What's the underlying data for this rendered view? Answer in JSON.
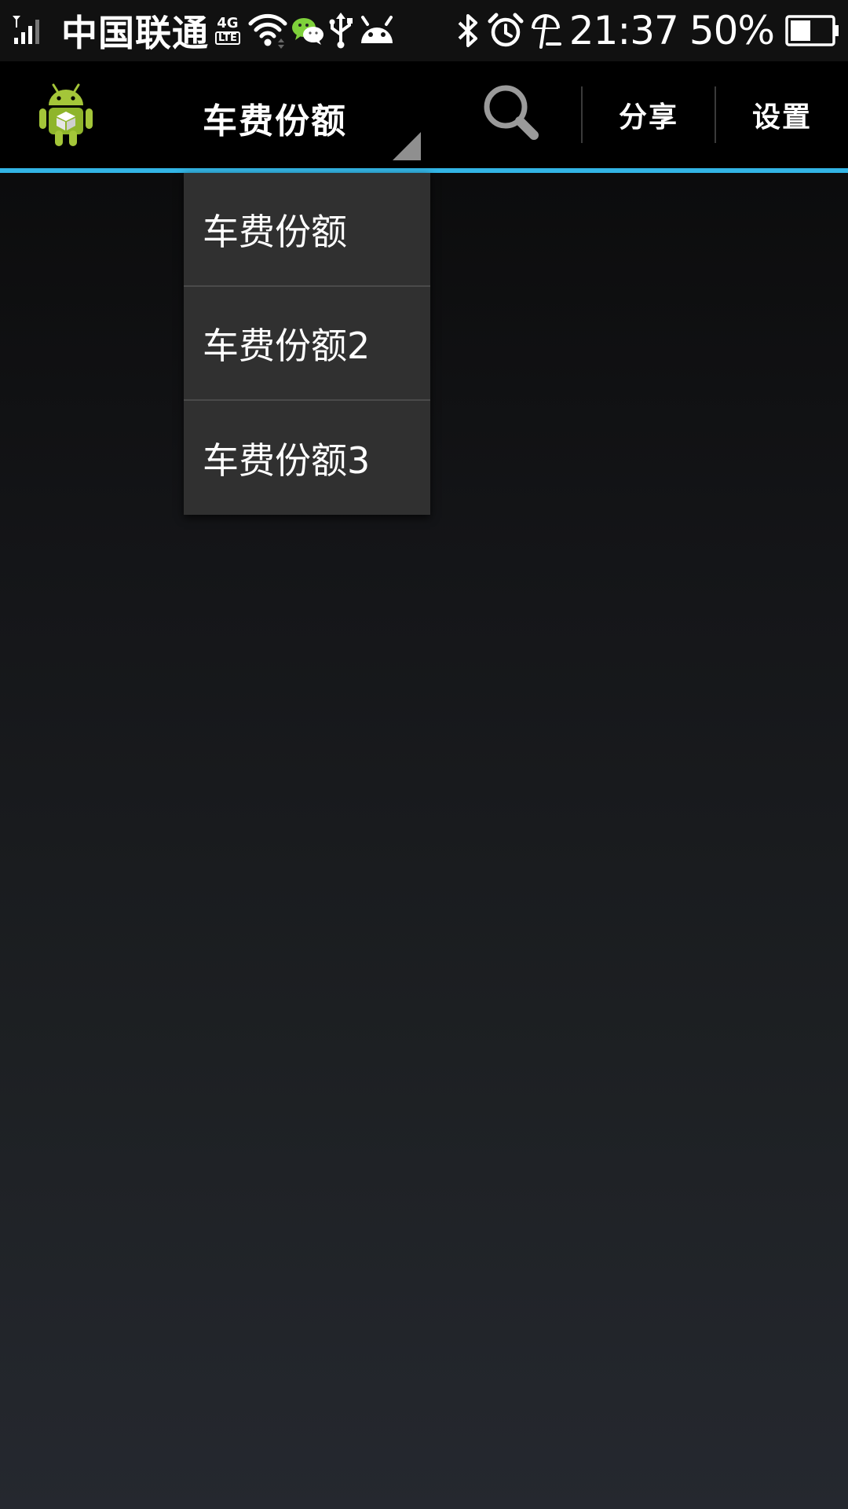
{
  "status_bar": {
    "carrier": "中国联通",
    "network_type_top": "4G",
    "network_type_bottom": "LTE",
    "time": "21:37",
    "battery_percent": "50%",
    "battery_level": 0.5,
    "icons": [
      "signal-icon",
      "wifi-icon",
      "wechat-icon",
      "usb-icon",
      "android-notification-icon",
      "bluetooth-icon",
      "alarm-icon",
      "vacation-mode-icon",
      "battery-icon"
    ]
  },
  "action_bar": {
    "spinner_title": "车费份额",
    "share_label": "分享",
    "settings_label": "设置",
    "underline_color": "#33b5e5"
  },
  "dropdown": {
    "items": [
      "车费份额",
      "车费份额2",
      "车费份额3"
    ]
  }
}
